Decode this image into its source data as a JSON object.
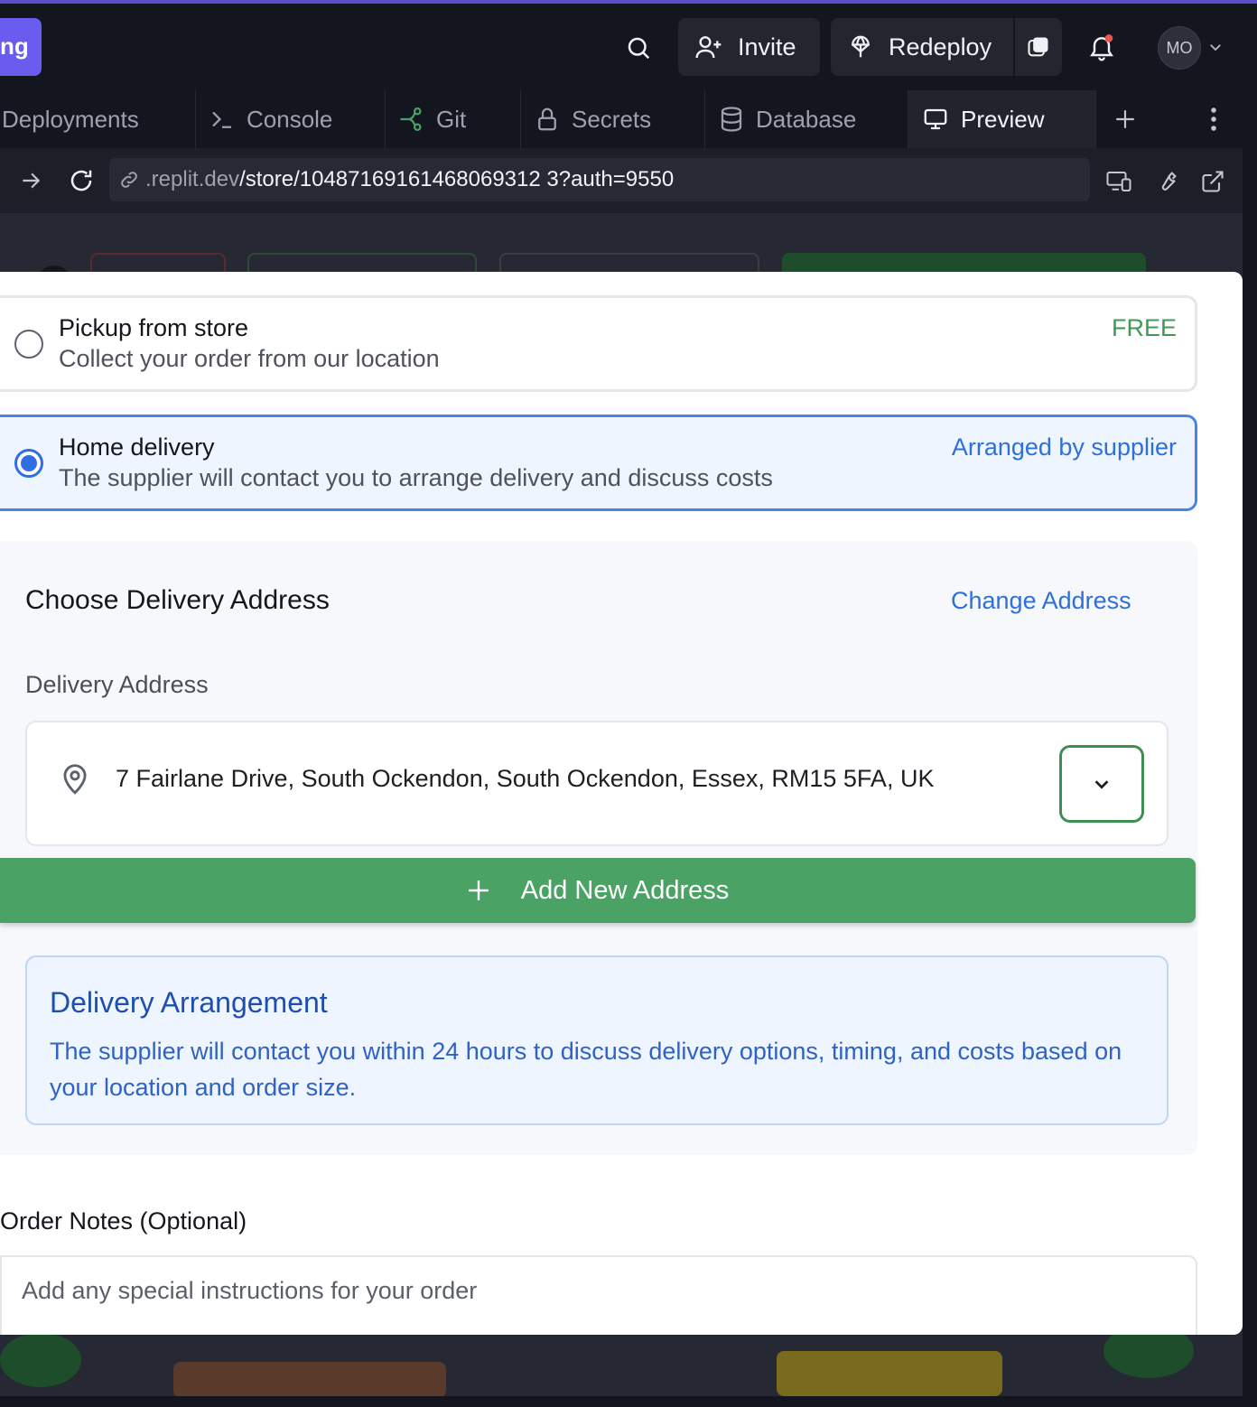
{
  "topbar": {
    "brand_fragment": "ng",
    "invite_label": "Invite",
    "redeploy_label": "Redeploy",
    "avatar_initials": "MO"
  },
  "tabs": [
    {
      "label": "Deployments"
    },
    {
      "label": "Console"
    },
    {
      "label": "Git"
    },
    {
      "label": "Secrets"
    },
    {
      "label": "Database"
    },
    {
      "label": "Preview"
    }
  ],
  "urlbar": {
    "domain": ".replit.dev",
    "path": "/store/10487169161468069312 3?auth=9550"
  },
  "delivery_options": {
    "pickup": {
      "title": "Pickup from store",
      "description": "Collect your order from our location",
      "tag": "FREE",
      "selected": false
    },
    "home": {
      "title": "Home delivery",
      "description": "The supplier will contact you to arrange delivery and discuss costs",
      "tag": "Arranged by supplier",
      "selected": true
    }
  },
  "address_panel": {
    "title": "Choose Delivery Address",
    "change_link": "Change Address",
    "field_label": "Delivery Address",
    "selected_address": "7 Fairlane Drive, South Ockendon, South Ockendon, Essex, RM15 5FA, UK",
    "add_button_label": "Add New Address"
  },
  "info": {
    "title": "Delivery Arrangement",
    "body": "The supplier will contact you within 24 hours to discuss delivery options, timing, and costs based on your location and order size."
  },
  "notes": {
    "label": "Order Notes (Optional)",
    "placeholder": "Add any special instructions for your order"
  },
  "colors": {
    "accent_green": "#4aa364",
    "accent_blue": "#2f6fd8",
    "free_green": "#3f9a55",
    "brand_purple": "#6b5cf0"
  }
}
